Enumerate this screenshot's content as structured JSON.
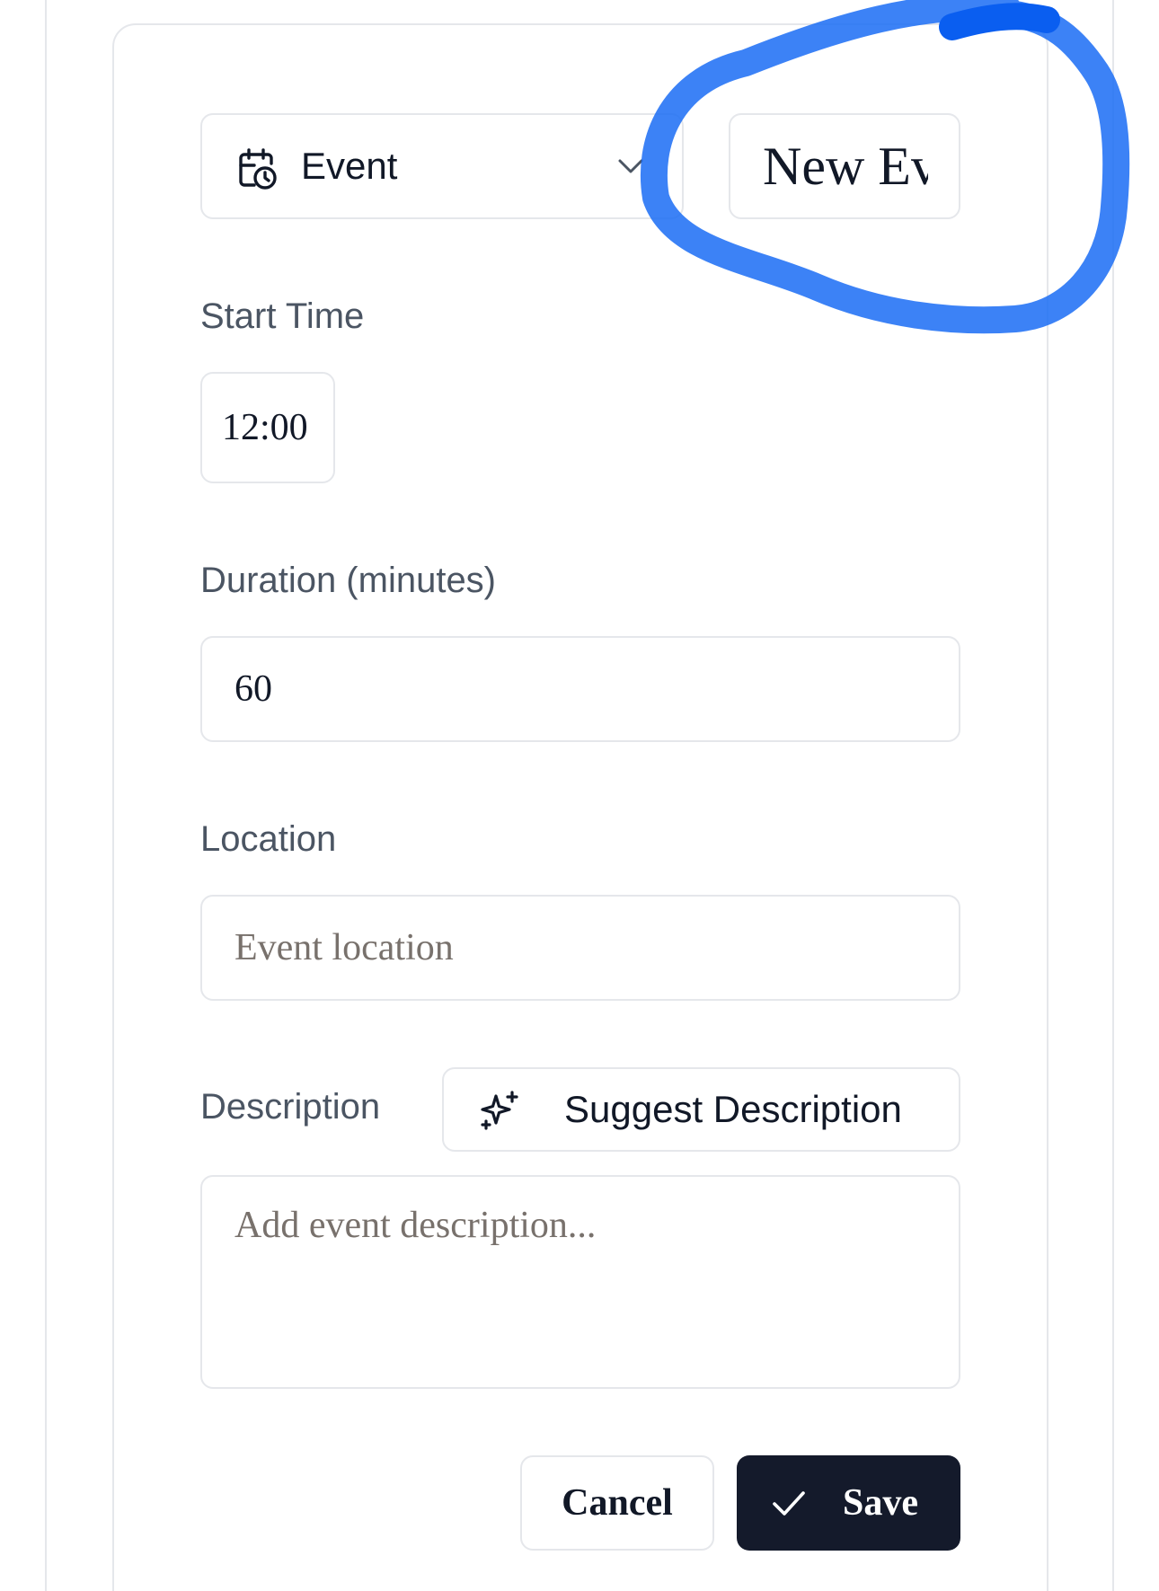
{
  "form": {
    "type_select": {
      "selected": "Event",
      "icon": "calendar-clock-icon"
    },
    "title_input": {
      "value": "New Event"
    },
    "start_time": {
      "label": "Start Time",
      "value": "12:00"
    },
    "duration": {
      "label": "Duration (minutes)",
      "value": "60"
    },
    "location": {
      "label": "Location",
      "value": "",
      "placeholder": "Event location"
    },
    "description": {
      "label": "Description",
      "suggest_label": "Suggest Description",
      "suggest_icon": "sparkles-icon",
      "value": "",
      "placeholder": "Add event description..."
    },
    "actions": {
      "cancel_label": "Cancel",
      "save_label": "Save",
      "save_icon": "check-icon"
    }
  },
  "colors": {
    "primary_button": "#141a2b",
    "border": "#e5e7eb",
    "label_text": "#4b5563",
    "annotation_stroke": "#1a6cf5"
  }
}
